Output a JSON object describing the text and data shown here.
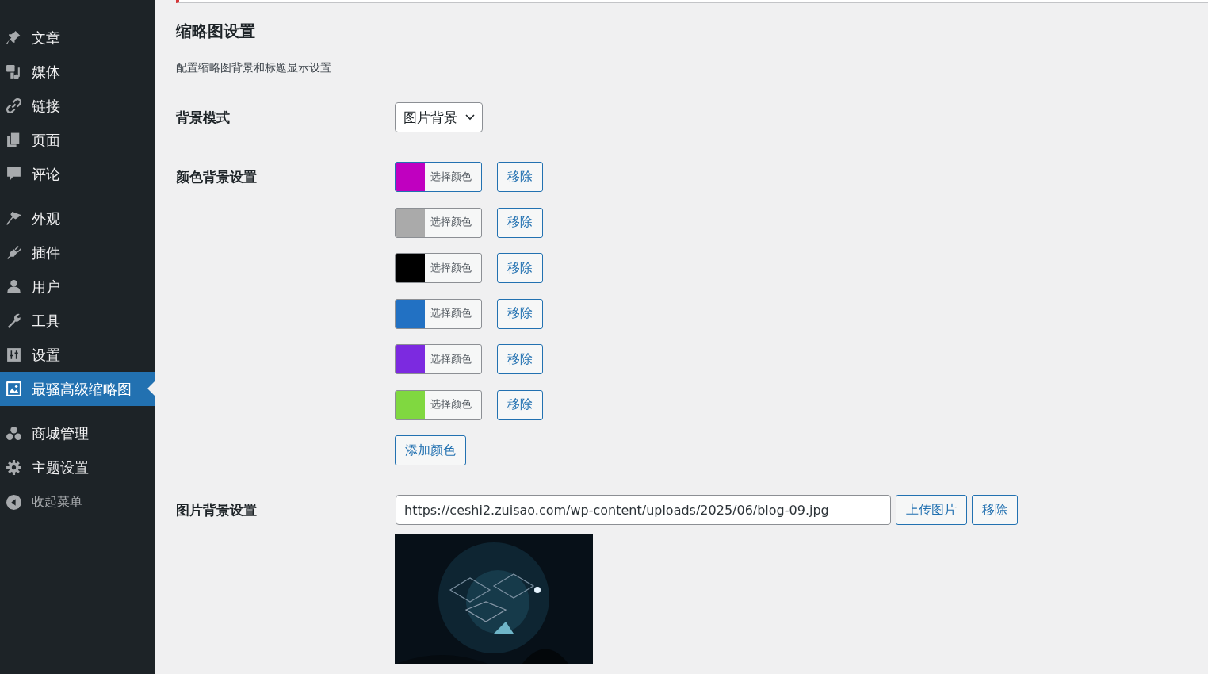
{
  "sidebar": {
    "groups": [
      [
        {
          "label": "文章",
          "selected": false
        },
        {
          "label": "媒体",
          "selected": false
        },
        {
          "label": "链接",
          "selected": false
        },
        {
          "label": "页面",
          "selected": false
        },
        {
          "label": "评论",
          "selected": false
        }
      ],
      [
        {
          "label": "外观",
          "selected": false
        },
        {
          "label": "插件",
          "selected": false
        },
        {
          "label": "用户",
          "selected": false
        },
        {
          "label": "工具",
          "selected": false
        },
        {
          "label": "设置",
          "selected": false
        },
        {
          "label": "最骚高级缩略图",
          "selected": true
        }
      ],
      [
        {
          "label": "商城管理",
          "selected": false
        },
        {
          "label": "主题设置",
          "selected": false
        }
      ]
    ],
    "collapse": "收起菜单"
  },
  "page": {
    "title": "缩略图设置",
    "description": "配置缩略图背景和标题显示设置"
  },
  "form": {
    "mode": {
      "label": "背景模式",
      "value": "图片背景"
    },
    "colors": {
      "label": "颜色背景设置",
      "items": [
        {
          "color": "#c000c0",
          "pick": "选择颜色",
          "remove": "移除",
          "focused": true
        },
        {
          "color": "#aaaaaa",
          "pick": "选择颜色",
          "remove": "移除",
          "focused": false
        },
        {
          "color": "#000000",
          "pick": "选择颜色",
          "remove": "移除",
          "focused": false
        },
        {
          "color": "#2271c3",
          "pick": "选择颜色",
          "remove": "移除",
          "focused": false
        },
        {
          "color": "#7c2ae0",
          "pick": "选择颜色",
          "remove": "移除",
          "focused": false
        },
        {
          "color": "#80d840",
          "pick": "选择颜色",
          "remove": "移除",
          "focused": false
        }
      ],
      "add": "添加颜色"
    },
    "image": {
      "label": "图片背景设置",
      "value": "https://ceshi2.zuisao.com/wp-content/uploads/2025/06/blog-09.jpg",
      "upload": "上传图片",
      "remove": "移除"
    }
  }
}
